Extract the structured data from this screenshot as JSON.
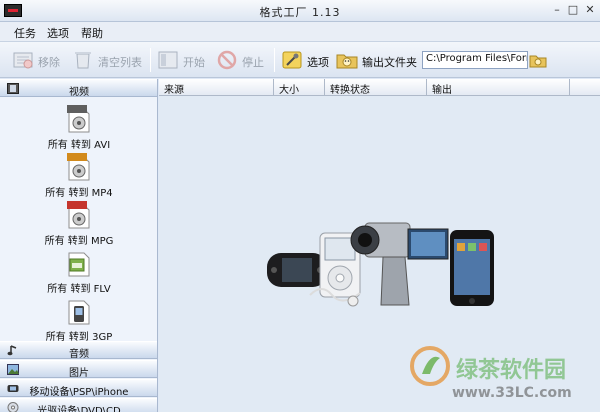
{
  "window": {
    "title": "格式工厂 1.13",
    "minimize": "–",
    "maximize": "□",
    "close": "✕"
  },
  "menu": [
    {
      "label": "任务"
    },
    {
      "label": "选项"
    },
    {
      "label": "帮助"
    }
  ],
  "toolbar": {
    "remove": "移除",
    "clear_list": "清空列表",
    "start": "开始",
    "stop": "停止",
    "options": "选项",
    "output_folder": "输出文件夹",
    "output_path": "C:\\Program Files\\Form"
  },
  "sidebar": {
    "categories": {
      "video": "视频",
      "audio": "音频",
      "image": "图片",
      "mobile": "移动设备\\PSP\\iPhone",
      "optical": "光驱设备\\DVD\\CD"
    },
    "video_formats": [
      {
        "label": "所有 转到 AVI",
        "badge": "AVI"
      },
      {
        "label": "所有 转到 MP4",
        "badge": "MP4"
      },
      {
        "label": "所有 转到 MPG",
        "badge": "MPG"
      },
      {
        "label": "所有 转到 FLV",
        "badge": "flv"
      },
      {
        "label": "所有 转到 3GP",
        "badge": "3GP"
      }
    ]
  },
  "list": {
    "columns": [
      "来源",
      "大小",
      "转换状态",
      "输出"
    ]
  },
  "watermark": {
    "text": "绿茶软件园",
    "url": "www.33LC.com"
  },
  "colors": {
    "accent": "#3d6fb6",
    "panel": "#e1eaf4",
    "sidebar": "#eef3fb"
  }
}
